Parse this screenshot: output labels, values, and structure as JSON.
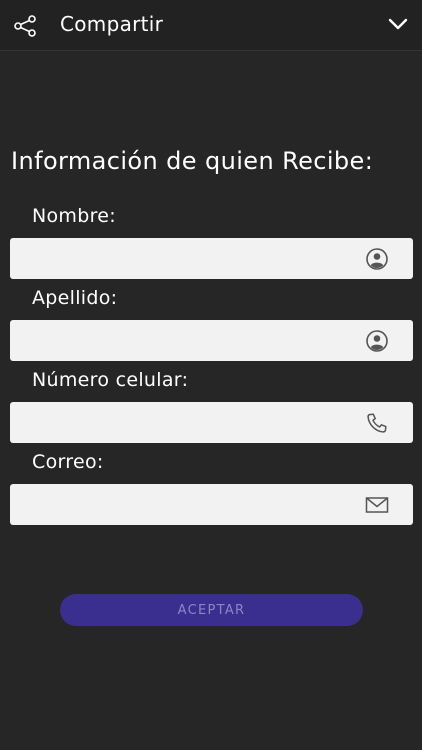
{
  "header": {
    "title": "Compartir",
    "left_icon": "share-icon",
    "right_icon": "chevron-down-icon"
  },
  "form": {
    "title": "Información de quien Recibe:",
    "fields": [
      {
        "label": "Nombre:",
        "value": "",
        "icon": "person-icon"
      },
      {
        "label": "Apellido:",
        "value": "",
        "icon": "person-icon"
      },
      {
        "label": "Número celular:",
        "value": "",
        "icon": "phone-icon"
      },
      {
        "label": "Correo:",
        "value": "",
        "icon": "mail-icon"
      }
    ],
    "submit_label": "ACEPTAR"
  },
  "colors": {
    "background": "#262626",
    "header_background": "#222222",
    "field_background": "#f2f2f2",
    "button_background": "#3a2f8f",
    "button_text": "#8c86c4"
  }
}
